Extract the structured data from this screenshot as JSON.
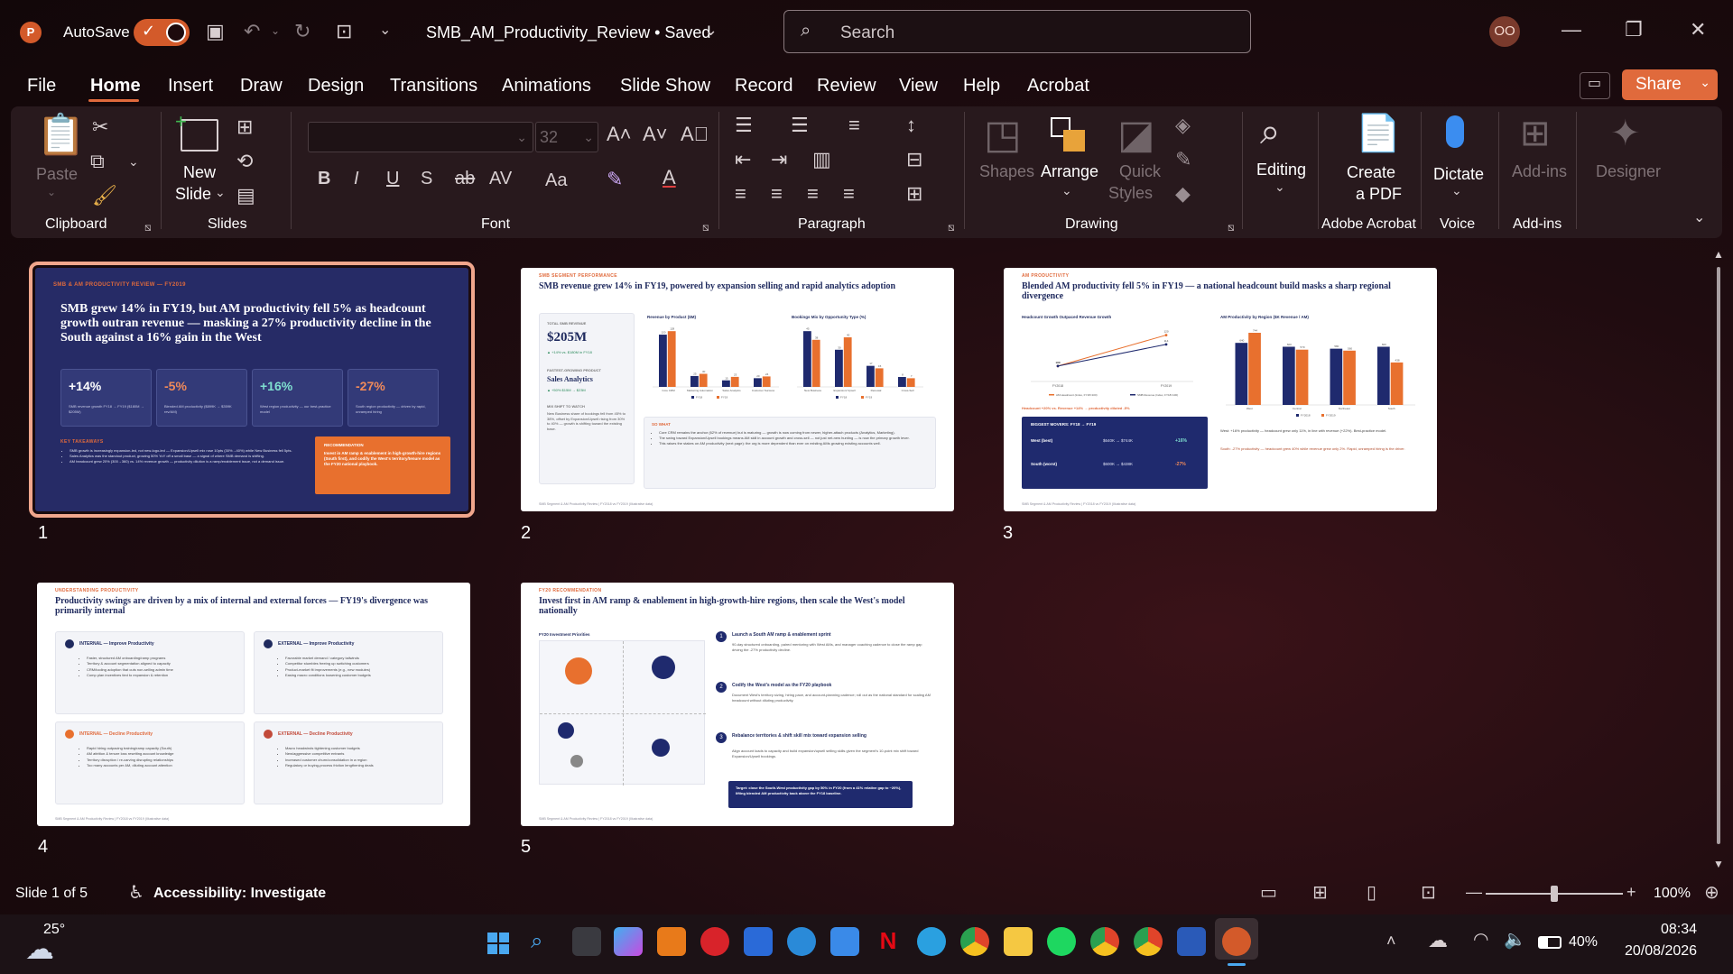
{
  "titlebar": {
    "autosave": "AutoSave",
    "doc_title": "SMB_AM_Productivity_Review • Saved",
    "search_placeholder": "Search",
    "avatar": "OO"
  },
  "menu": [
    "File",
    "Home",
    "Insert",
    "Draw",
    "Design",
    "Transitions",
    "Animations",
    "Slide Show",
    "Record",
    "Review",
    "View",
    "Help",
    "Acrobat"
  ],
  "share": "Share",
  "ribbon": {
    "paste": "Paste",
    "new_slide_1": "New",
    "new_slide_2": "Slide",
    "font_size": "32",
    "shapes": "Shapes",
    "arrange": "Arrange",
    "quick_styles_1": "Quick",
    "quick_styles_2": "Styles",
    "editing": "Editing",
    "create_pdf_1": "Create",
    "create_pdf_2": "a PDF",
    "dictate": "Dictate",
    "addins": "Add-ins",
    "designer": "Designer",
    "groups": {
      "clipboard": "Clipboard",
      "slides": "Slides",
      "font": "Font",
      "paragraph": "Paragraph",
      "drawing": "Drawing",
      "adobe": "Adobe Acrobat",
      "voice": "Voice",
      "addins": "Add-ins"
    }
  },
  "slides": {
    "s1": {
      "num": "1",
      "eyebrow": "SMB & AM PRODUCTIVITY REVIEW — FY2019",
      "title": "SMB grew 14% in FY19, but AM productivity fell 5% as headcount growth outran revenue — masking a 27% productivity decline in the South against a 16% gain in the West",
      "kpis": [
        {
          "v": "+14%",
          "d": "SMB revenue growth FY18 → FY19 ($180M → $205M)"
        },
        {
          "v": "-5%",
          "d": "Blended AM productivity ($899K → $359K rev/AM)"
        },
        {
          "v": "+16%",
          "d": "West region productivity — our best-practice model"
        },
        {
          "v": "-27%",
          "d": "South region productivity — driven by rapid, unramped hiring"
        }
      ],
      "takeaways_h": "KEY TAKEAWAYS",
      "takeaways": [
        "SMB growth is increasingly expansion-led, not new-logo-led — Expansion/Upsell mix rose 10pts (30%→40%) while New Business fell 5pts.",
        "Sales Analytics was the standout product, growing 50% YoY off a small base — a signal of where SMB demand is shifting.",
        "AM headcount grew 20% (300→360) vs. 14% revenue growth — productivity dilution is a ramp/enablement issue, not a demand issue."
      ],
      "rec_h": "RECOMMENDATION",
      "rec": "Invest in AM ramp & enablement in high-growth-hire regions (South first), and codify the West's territory/tenure model as the FY20 national playbook."
    },
    "s2": {
      "num": "2",
      "eyebrow": "SMB SEGMENT PERFORMANCE",
      "title": "SMB revenue grew 14% in FY19, powered by expansion selling and rapid analytics adoption",
      "kpi_h": "TOTAL SMB REVENUE",
      "kpi_v": "$205M",
      "kpi_d": "▲ +14% vs. $180M in FY18",
      "prod_h": "FASTEST-GROWING PRODUCT",
      "prod_v": "Sales Analytics",
      "prod_d": "▲ +50% $15M → $23M",
      "mix_h": "MIX SHIFT TO WATCH",
      "mix_d": "New Business share of bookings fell from 45% to 38%, offset by Expansion/Upsell rising from 30% to 40% — growth is shifting toward the existing base.",
      "c1_title": "Revenue by Product ($M)",
      "c2_title": "Bookings Mix by Opportunity Type (%)",
      "so_h": "SO WHAT",
      "so": [
        "Core CRM remains the anchor (62% of revenue) but is maturing — growth is now coming from newer, higher-attach products (Analytics, Marketing).",
        "The swing toward Expansion/Upsell bookings means AM skill in account growth and cross-sell — not just net-new hunting — is now the primary growth lever.",
        "This raises the stakes on AM productivity (next page): the org is more dependent than ever on existing AMs growing existing accounts well."
      ]
    },
    "s3": {
      "num": "3",
      "eyebrow": "AM PRODUCTIVITY",
      "title": "Blended AM productivity fell 5% in FY19 — a national headcount build masks a sharp regional divergence",
      "c1_title": "Headcount Growth Outpaced Revenue Growth",
      "c2_title": "AM Productivity by Region ($K Revenue / AM)",
      "regions": [
        "West",
        "Central",
        "Northeast",
        "South"
      ],
      "movers_h": "BIGGEST MOVERS: FY18 → FY19",
      "movers": [
        {
          "r": "West (best)",
          "v": "$640K → $744K",
          "p": "+16%"
        },
        {
          "r": "South (worst)",
          "v": "$600K → $438K",
          "p": "-27%"
        }
      ],
      "note1": "Headcount +20% vs. Revenue +14% → productivity diluted -5%",
      "note2": "West: +16% productivity — headcount grew only 11%, in line with revenue (+22%). Best-practice model.",
      "note3": "South: -27% productivity — headcount grew 40% while revenue grew only 2%. Rapid, unramped hiring is the driver."
    },
    "s4": {
      "num": "4",
      "eyebrow": "UNDERSTANDING PRODUCTIVITY",
      "title": "Productivity swings are driven by a mix of internal and external forces — FY19's divergence was primarily internal",
      "quads": [
        {
          "h": "INTERNAL — Improve Productivity",
          "items": [
            "Faster, structured AM onboarding/ramp programs",
            "Territory & account segmentation aligned to capacity",
            "CRM/tooling adoption that cuts non-selling admin time",
            "Comp plan incentives tied to expansion & retention"
          ]
        },
        {
          "h": "EXTERNAL — Improve Productivity",
          "items": [
            "Favorable market demand / category tailwinds",
            "Competitor stumbles freeing up switching customers",
            "Product-market fit improvements (e.g., new modules)",
            "Easing macro conditions loosening customer budgets"
          ]
        },
        {
          "h": "INTERNAL — Decline Productivity",
          "items": [
            "Rapid hiring outpacing training/ramp capacity (South)",
            "AM attrition & tenure loss resetting account knowledge",
            "Territory disruption / re-carving disrupting relationships",
            "Too many accounts per AM, diluting account attention"
          ]
        },
        {
          "h": "EXTERNAL — Decline Productivity",
          "items": [
            "Macro headwinds tightening customer budgets",
            "New/aggressive competitive entrants",
            "Increased customer churn/consolidation in a region",
            "Regulatory or buying-process friction lengthening deals"
          ]
        }
      ]
    },
    "s5": {
      "num": "5",
      "eyebrow": "FY20 RECOMMENDATION",
      "title": "Invest first in AM ramp & enablement in high-growth-hire regions, then scale the West's model nationally",
      "matrix_h": "FY20 Investment Priorities",
      "steps": [
        {
          "n": "1",
          "h": "Launch a South AM ramp & enablement sprint",
          "d": "90-day structured onboarding, paired mentoring with West AMs, and manager coaching cadence to close the ramp gap driving the -27% productivity decline."
        },
        {
          "n": "2",
          "h": "Codify the West's model as the FY20 playbook",
          "d": "Document West's territory sizing, hiring pace, and account-planning cadence; roll out as the national standard for scaling AM headcount without diluting productivity."
        },
        {
          "n": "3",
          "h": "Rebalance territories & shift skill mix toward expansion selling",
          "d": "Align account loads to capacity and build expansion/upsell selling skills given the segment's 10-point mix shift toward Expansion/Upsell bookings."
        }
      ],
      "target": "Target: close the South-West productivity gap by 50% in FY20 (from a 41% relative gap to ~20%), lifting blended AM productivity back above the FY18 baseline."
    }
  },
  "chart_s2a": {
    "type": "bar",
    "categories": [
      "Core CRM",
      "Marketing Automation",
      "Sales Analytics",
      "Customer Success"
    ],
    "series": [
      {
        "name": "FY18",
        "values": [
          120,
          25,
          15,
          20
        ]
      },
      {
        "name": "FY19",
        "values": [
          128,
          30,
          23,
          24
        ]
      }
    ]
  },
  "chart_s2b": {
    "type": "bar",
    "categories": [
      "New Business",
      "Expansion/ Upsell",
      "Renewal",
      "Cross-Sell"
    ],
    "series": [
      {
        "name": "FY18",
        "values": [
          45,
          30,
          17,
          8
        ]
      },
      {
        "name": "FY19",
        "values": [
          38,
          40,
          15,
          7
        ]
      }
    ]
  },
  "chart_s3a": {
    "type": "line",
    "x": [
      "FY2018",
      "FY2019"
    ],
    "series": [
      {
        "name": "AM Headcount (Index, FY18=100)",
        "values": [
          100,
          120
        ]
      },
      {
        "name": "SMB Revenue (Index, FY18=100)",
        "values": [
          100,
          114
        ]
      }
    ]
  },
  "chart_s3b": {
    "type": "bar",
    "categories": [
      "West",
      "Central",
      "Northeast",
      "South"
    ],
    "series": [
      {
        "name": "FY2018",
        "values": [
          640,
          600,
          580,
          600
        ]
      },
      {
        "name": "FY2019",
        "values": [
          744,
          570,
          560,
          438
        ]
      }
    ]
  },
  "status": {
    "slide_of": "Slide 1 of 5",
    "accessibility": "Accessibility: Investigate",
    "zoom": "100%"
  },
  "taskbar": {
    "temp": "25°",
    "battery": "40%",
    "time": "08:34",
    "date": "20/08/2026"
  },
  "colors": {
    "accent": "#e06a3c",
    "navy": "#1f2a5e",
    "ribbon_bg": "#28191d"
  }
}
